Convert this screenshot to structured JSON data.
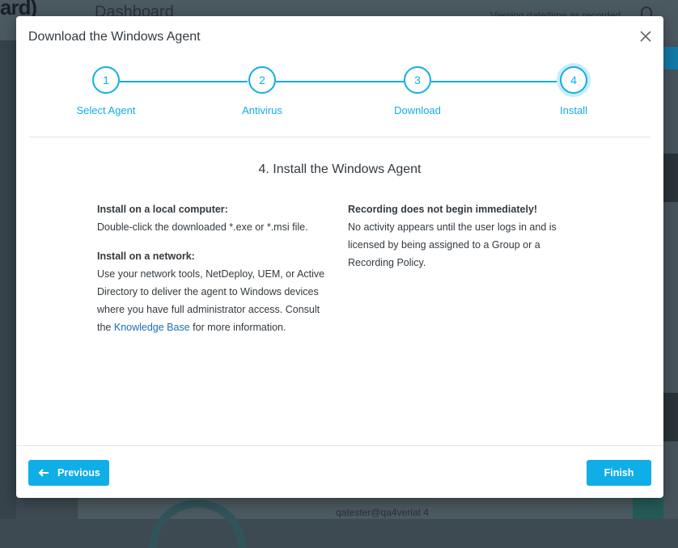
{
  "background": {
    "logo_text": "ard)",
    "page_title": "Dashboard",
    "date_note": "Viewing date/time as recorded",
    "bottom_text": "qatester@qa4veriat   4"
  },
  "modal": {
    "title": "Download the Windows Agent",
    "steps": [
      {
        "number": "1",
        "label": "Select Agent"
      },
      {
        "number": "2",
        "label": "Antivirus"
      },
      {
        "number": "3",
        "label": "Download"
      },
      {
        "number": "4",
        "label": "Install"
      }
    ],
    "active_step": 4,
    "heading": "4. Install the Windows Agent",
    "left": {
      "local_heading": "Install on a local computer:",
      "local_text": "Double-click the downloaded *.exe or *.msi file.",
      "network_heading": "Install on a network:",
      "network_text_before": "Use your network tools, NetDeploy, UEM, or Active Directory to deliver the agent to Windows devices where you have full administrator access. Consult the ",
      "kb_link": "Knowledge Base",
      "network_text_after": " for more information."
    },
    "right": {
      "heading": "Recording does not begin immediately!",
      "text": "No activity appears until the user logs in and is licensed by being assigned to a Group or a Recording Policy."
    },
    "buttons": {
      "previous": "Previous",
      "finish": "Finish"
    }
  },
  "colors": {
    "accent": "#10aee6",
    "link": "#1a6fb5"
  }
}
